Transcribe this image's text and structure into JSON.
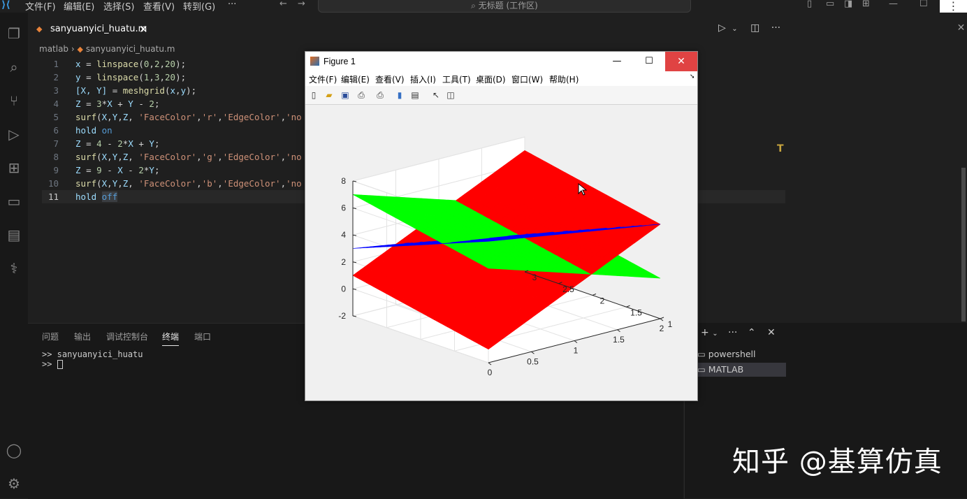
{
  "titlebar": {
    "menu": [
      "文件(F)",
      "编辑(E)",
      "选择(S)",
      "查看(V)",
      "转到(G)",
      "···"
    ],
    "command_center": "无标题 (工作区)",
    "more": "⋮"
  },
  "editor": {
    "tab_label": "sanyuanyici_huatu.m",
    "breadcrumb_folder": "matlab",
    "breadcrumb_file": "sanyuanyici_huatu.m",
    "lines": [
      {
        "n": "1"
      },
      {
        "n": "2"
      },
      {
        "n": "3"
      },
      {
        "n": "4"
      },
      {
        "n": "5"
      },
      {
        "n": "6"
      },
      {
        "n": "7"
      },
      {
        "n": "8"
      },
      {
        "n": "9"
      },
      {
        "n": "10"
      },
      {
        "n": "11"
      }
    ]
  },
  "panel": {
    "tabs": [
      "问题",
      "输出",
      "调试控制台",
      "终端",
      "端口"
    ],
    "active_tab": "终端",
    "terminal_lines": [
      ">> sanyuanyici_huatu",
      ">> "
    ],
    "terminals": [
      "powershell",
      "MATLAB"
    ]
  },
  "figure": {
    "title": "Figure 1",
    "menu": [
      "文件(F)",
      "编辑(E)",
      "查看(V)",
      "插入(I)",
      "工具(T)",
      "桌面(D)",
      "窗口(W)",
      "帮助(H)"
    ]
  },
  "watermark": "知乎 @基算仿真",
  "chart_data": {
    "type": "surface",
    "title": "",
    "xlabel": "",
    "ylabel": "",
    "zlabel": "",
    "x_ticks": [
      "0",
      "0.5",
      "1",
      "1.5",
      "2"
    ],
    "y_ticks": [
      "1",
      "1.5",
      "2",
      "2.5",
      "3"
    ],
    "z_ticks": [
      "-2",
      "0",
      "2",
      "4",
      "6",
      "8"
    ],
    "xlim": [
      0,
      2
    ],
    "ylim": [
      1,
      3
    ],
    "zlim": [
      -2,
      8
    ],
    "grid": true,
    "series": [
      {
        "equation": "Z = 3*X + Y - 2",
        "color": "#ff0000"
      },
      {
        "equation": "Z = 4 - 2*X + Y",
        "color": "#00ff00"
      },
      {
        "equation": "Z = 9 - X - 2*Y",
        "color": "#0000ff"
      }
    ]
  }
}
